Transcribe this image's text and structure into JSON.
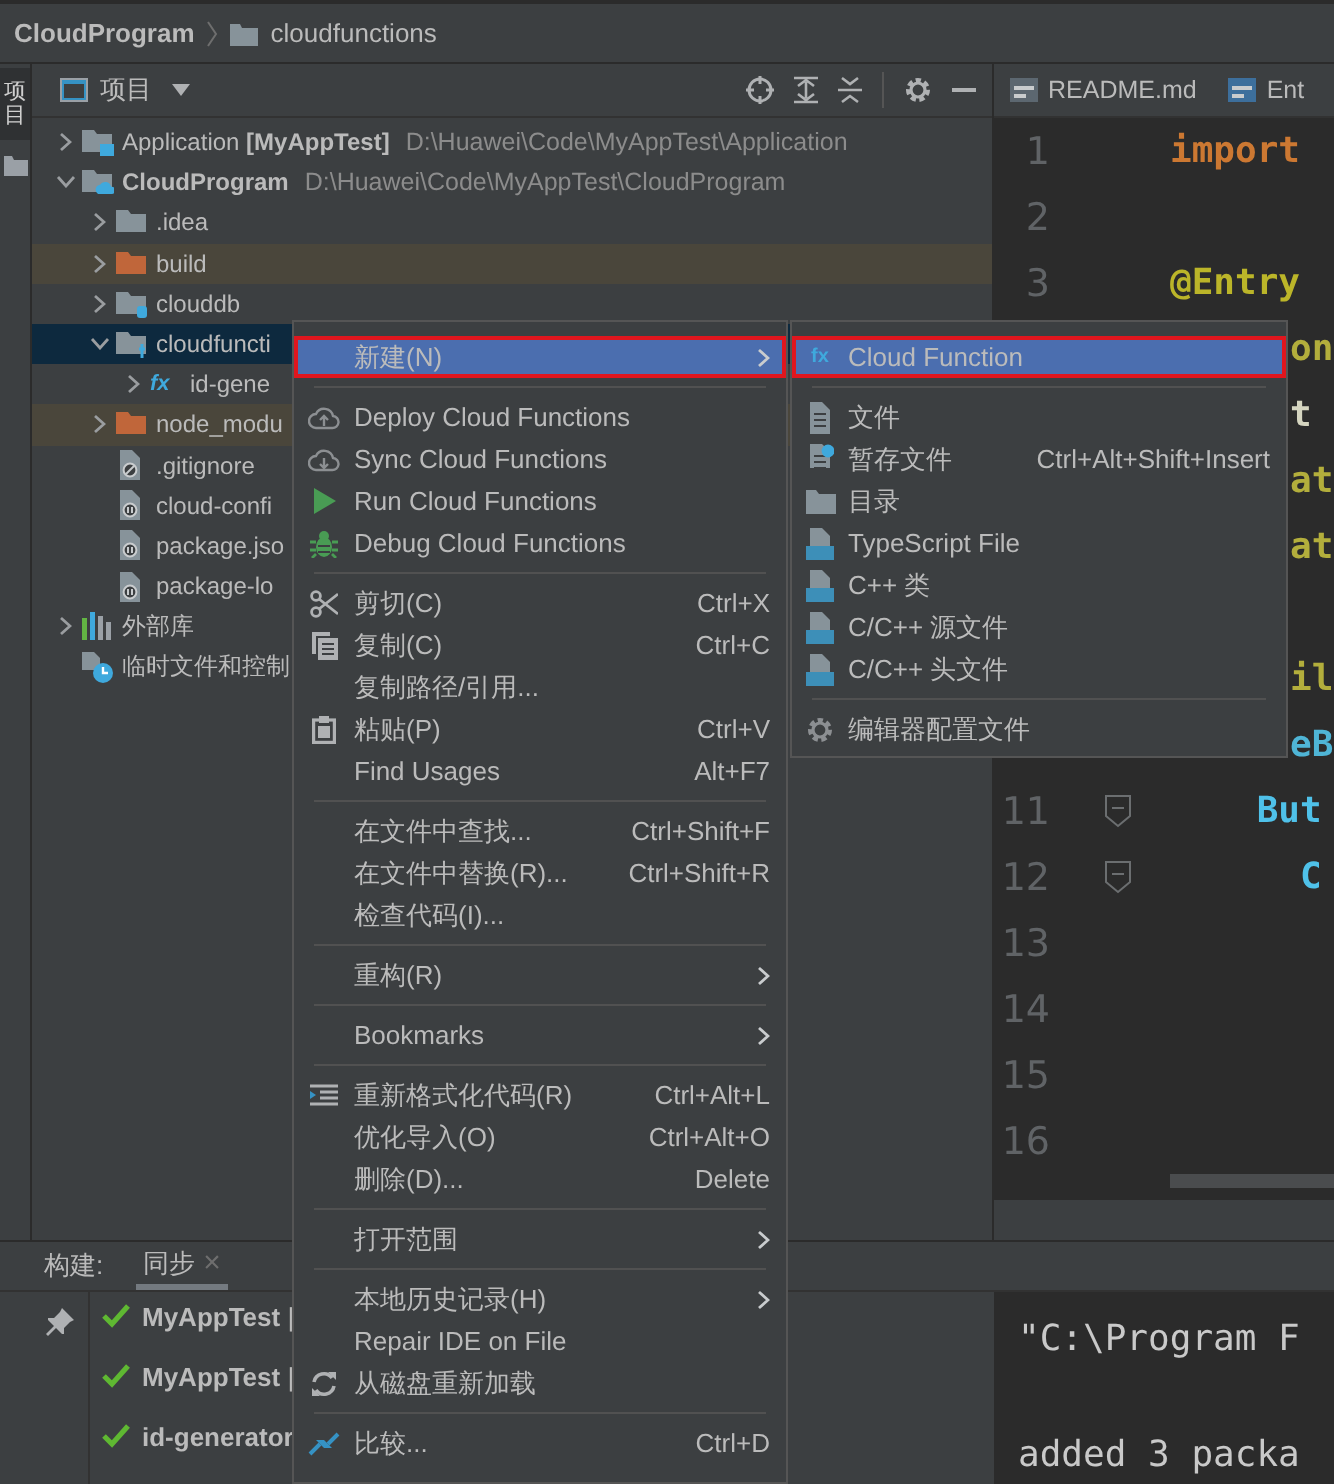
{
  "breadcrumb": {
    "project": "CloudProgram",
    "folder": "cloudfunctions"
  },
  "tool_strip": {
    "tab": "项目"
  },
  "project_panel": {
    "title": "项目",
    "tree": [
      {
        "name": "Application **[MyAppTest]**",
        "path": "D:\\Huawei\\Code\\MyAppTest\\Application",
        "kind": "module",
        "expanded": false,
        "selected": false
      },
      {
        "name": "**CloudProgram**",
        "path": "D:\\Huawei\\Code\\MyAppTest\\CloudProgram",
        "kind": "cloudmodule",
        "expanded": true,
        "selected": false,
        "children": [
          {
            "name": ".idea",
            "kind": "folder",
            "expanded": false,
            "excluded": false,
            "selected": false
          },
          {
            "name": "build",
            "kind": "folder",
            "expanded": false,
            "excluded": true,
            "selected": false
          },
          {
            "name": "clouddb",
            "kind": "dbfolder",
            "expanded": false,
            "excluded": false,
            "selected": false
          },
          {
            "name": "cloudfuncti",
            "kind": "fnfolder",
            "expanded": true,
            "excluded": false,
            "selected": true,
            "children": [
              {
                "name": "id-gene",
                "kind": "function",
                "icon_text": "fx",
                "expanded": false,
                "selected": false
              }
            ]
          },
          {
            "name": "node_modu",
            "kind": "folder",
            "expanded": false,
            "excluded": true,
            "selected": false
          },
          {
            "name": ".gitignore",
            "kind": "ignorefile",
            "selected": false
          },
          {
            "name": "cloud-confi",
            "kind": "configfile",
            "selected": false
          },
          {
            "name": "package.jso",
            "kind": "configfile",
            "selected": false
          },
          {
            "name": "package-lo",
            "kind": "configfile",
            "selected": false
          }
        ]
      },
      {
        "name": "外部库",
        "kind": "library",
        "expanded": false,
        "selected": false
      },
      {
        "name": "临时文件和控制",
        "kind": "scratches",
        "selected": false
      }
    ]
  },
  "context_menu": {
    "items": [
      {
        "kind": "item",
        "label": "新建(N)",
        "submenu": true,
        "selected": true,
        "marked": true
      },
      {
        "kind": "separator"
      },
      {
        "kind": "item",
        "label": "Deploy Cloud Functions",
        "selected": false
      },
      {
        "kind": "item",
        "label": "Sync Cloud Functions",
        "selected": false
      },
      {
        "kind": "item",
        "label": "Run Cloud Functions",
        "selected": false
      },
      {
        "kind": "item",
        "label": "Debug Cloud Functions",
        "selected": false
      },
      {
        "kind": "separator"
      },
      {
        "kind": "item",
        "label": "剪切(C)",
        "shortcut": "Ctrl+X",
        "selected": false
      },
      {
        "kind": "item",
        "label": "复制(C)",
        "shortcut": "Ctrl+C",
        "selected": false
      },
      {
        "kind": "item",
        "label": "复制路径/引用...",
        "selected": false
      },
      {
        "kind": "item",
        "label": "粘贴(P)",
        "shortcut": "Ctrl+V",
        "selected": false
      },
      {
        "kind": "item",
        "label": "Find Usages",
        "shortcut": "Alt+F7",
        "selected": false
      },
      {
        "kind": "separator"
      },
      {
        "kind": "item",
        "label": "在文件中查找...",
        "shortcut": "Ctrl+Shift+F",
        "selected": false
      },
      {
        "kind": "item",
        "label": "在文件中替换(R)...",
        "shortcut": "Ctrl+Shift+R",
        "selected": false
      },
      {
        "kind": "item",
        "label": "检查代码(I)...",
        "selected": false
      },
      {
        "kind": "separator"
      },
      {
        "kind": "item",
        "label": "重构(R)",
        "submenu": true,
        "selected": false
      },
      {
        "kind": "separator"
      },
      {
        "kind": "item",
        "label": "Bookmarks",
        "submenu": true,
        "selected": false
      },
      {
        "kind": "separator"
      },
      {
        "kind": "item",
        "label": "重新格式化代码(R)",
        "shortcut": "Ctrl+Alt+L",
        "selected": false
      },
      {
        "kind": "item",
        "label": "优化导入(O)",
        "shortcut": "Ctrl+Alt+O",
        "selected": false
      },
      {
        "kind": "item",
        "label": "删除(D)...",
        "shortcut": "Delete",
        "selected": false
      },
      {
        "kind": "separator"
      },
      {
        "kind": "item",
        "label": "打开范围",
        "submenu": true,
        "selected": false
      },
      {
        "kind": "separator"
      },
      {
        "kind": "item",
        "label": "本地历史记录(H)",
        "submenu": true,
        "selected": false
      },
      {
        "kind": "item",
        "label": "Repair IDE on File",
        "selected": false
      },
      {
        "kind": "item",
        "label": "从磁盘重新加载",
        "selected": false
      },
      {
        "kind": "separator"
      },
      {
        "kind": "item",
        "label": "比较...",
        "shortcut": "Ctrl+D",
        "selected": false
      }
    ]
  },
  "new_submenu": {
    "items": [
      {
        "kind": "item",
        "label": "Cloud Function",
        "icon_text": "fx",
        "selected": true,
        "marked": true
      },
      {
        "kind": "separator"
      },
      {
        "kind": "item",
        "label": "文件",
        "selected": false
      },
      {
        "kind": "item",
        "label": "暂存文件",
        "shortcut": "Ctrl+Alt+Shift+Insert",
        "selected": false
      },
      {
        "kind": "item",
        "label": "目录",
        "selected": false
      },
      {
        "kind": "item",
        "label": "TypeScript File",
        "selected": false
      },
      {
        "kind": "item",
        "label": "C++ 类",
        "selected": false
      },
      {
        "kind": "item",
        "label": "C/C++ 源文件",
        "selected": false
      },
      {
        "kind": "item",
        "label": "C/C++ 头文件",
        "selected": false
      },
      {
        "kind": "separator"
      },
      {
        "kind": "item",
        "label": "编辑器配置文件",
        "selected": false
      }
    ]
  },
  "editor": {
    "tabs": [
      {
        "label": "README.md"
      },
      {
        "label": "Ent"
      }
    ],
    "lines": [
      {
        "kind": "line",
        "number": "1",
        "code": "import",
        "color": "#cc7832"
      },
      {
        "kind": "line",
        "number": "2"
      },
      {
        "kind": "line",
        "number": "3",
        "code": "@Entry",
        "color": "#bbb529"
      },
      {
        "kind": "line",
        "code": "on",
        "color": "#b3ae3c"
      },
      {
        "kind": "line",
        "code": "t",
        "color": "#d5d5c0"
      },
      {
        "kind": "line",
        "code": "at",
        "color": "#b3ae3c"
      },
      {
        "kind": "line",
        "code": "at",
        "color": "#b3ae3c"
      },
      {
        "kind": "blank"
      },
      {
        "kind": "line",
        "code": "il",
        "color": "#b3ae3c"
      },
      {
        "kind": "line",
        "code": "eB",
        "color": "#4fb5d6"
      },
      {
        "kind": "line",
        "number": "11",
        "code": "    But",
        "color": "#4fc1e9",
        "fold": true
      },
      {
        "kind": "line",
        "number": "12",
        "code": "      C",
        "color": "#4fc1e9",
        "fold": true
      },
      {
        "kind": "line",
        "number": "13"
      },
      {
        "kind": "line",
        "number": "14"
      },
      {
        "kind": "line",
        "number": "15"
      },
      {
        "kind": "line",
        "number": "16"
      }
    ]
  },
  "build_panel": {
    "label": "构建:",
    "tabs": [
      {
        "label": "同步",
        "close": "×",
        "selected": true
      }
    ],
    "rows": [
      {
        "text": "**MyAppTest** |"
      },
      {
        "text": "**MyAppTest** |"
      },
      {
        "text": "**id-generator**"
      }
    ],
    "console": [
      "\"C:\\Program F",
      "added 3 packa"
    ]
  }
}
